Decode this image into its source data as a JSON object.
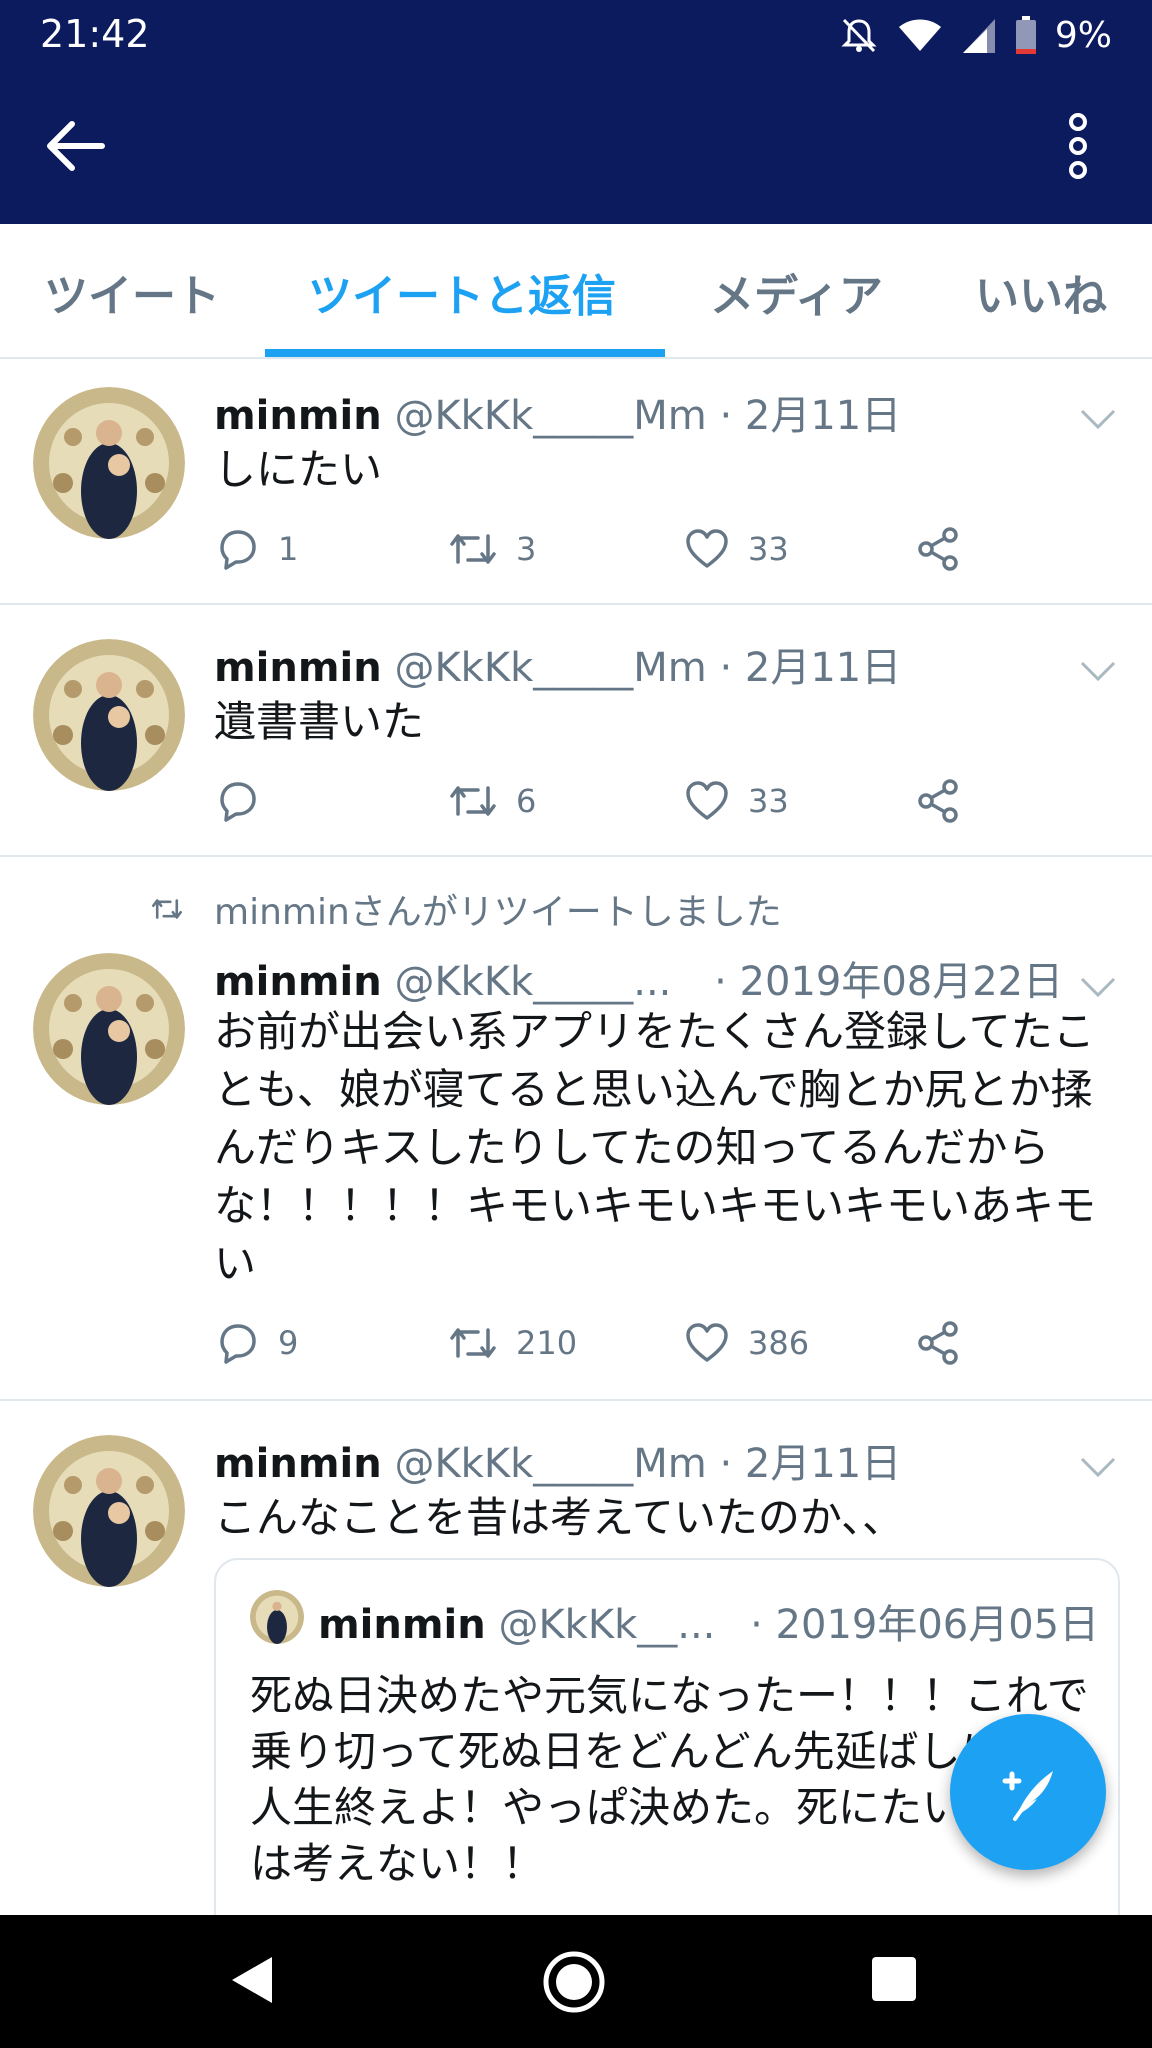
{
  "status": {
    "time": "21:42",
    "battery": "9%"
  },
  "colors": {
    "appbar": "#0c1a5e",
    "accent": "#1da1f2",
    "muted": "#657786"
  },
  "tabs": [
    {
      "label": "ツイート"
    },
    {
      "label": "ツイートと返信"
    },
    {
      "label": "メディア"
    },
    {
      "label": "いいね"
    }
  ],
  "tweets": [
    {
      "name": "minmin",
      "handle": "@KkKk_____Mm",
      "date": "· 2月11日",
      "text": "しにたい",
      "reply_count": "1",
      "retweet_count": "3",
      "like_count": "33"
    },
    {
      "name": "minmin",
      "handle": "@KkKk_____Mm",
      "date": "· 2月11日",
      "text": "遺書書いた",
      "reply_count": "",
      "retweet_count": "6",
      "like_count": "33"
    },
    {
      "retweet_note": "minminさんがリツイートしました",
      "name": "minmin",
      "handle": "@KkKk_____...",
      "date": "· 2019年08月22日",
      "text": "お前が出会い系アプリをたくさん登録してたことも、娘が寝てると思い込んで胸とか尻とか揉んだりキスしたりしてたの知ってるんだからな！！！！！キモいキモいキモいキモいあキモい",
      "reply_count": "9",
      "retweet_count": "210",
      "like_count": "386"
    },
    {
      "name": "minmin",
      "handle": "@KkKk_____Mm",
      "date": "· 2月11日",
      "text": "こんなことを昔は考えていたのか、、",
      "quote": {
        "name": "minmin",
        "handle": "@KkKk__...",
        "date": "· 2019年06月05日",
        "text": "死ぬ日決めたや元気になったー！！！これで乗り切って死ぬ日をどんどん先延ばしにして人生終えよ！やっぱ決めた。死にたいけど今は考えない！！"
      }
    }
  ],
  "icons": [
    "back-arrow-icon",
    "more-vertical-icon",
    "reply-icon",
    "retweet-icon",
    "like-icon",
    "share-icon",
    "chevron-down-icon",
    "compose-icon"
  ]
}
